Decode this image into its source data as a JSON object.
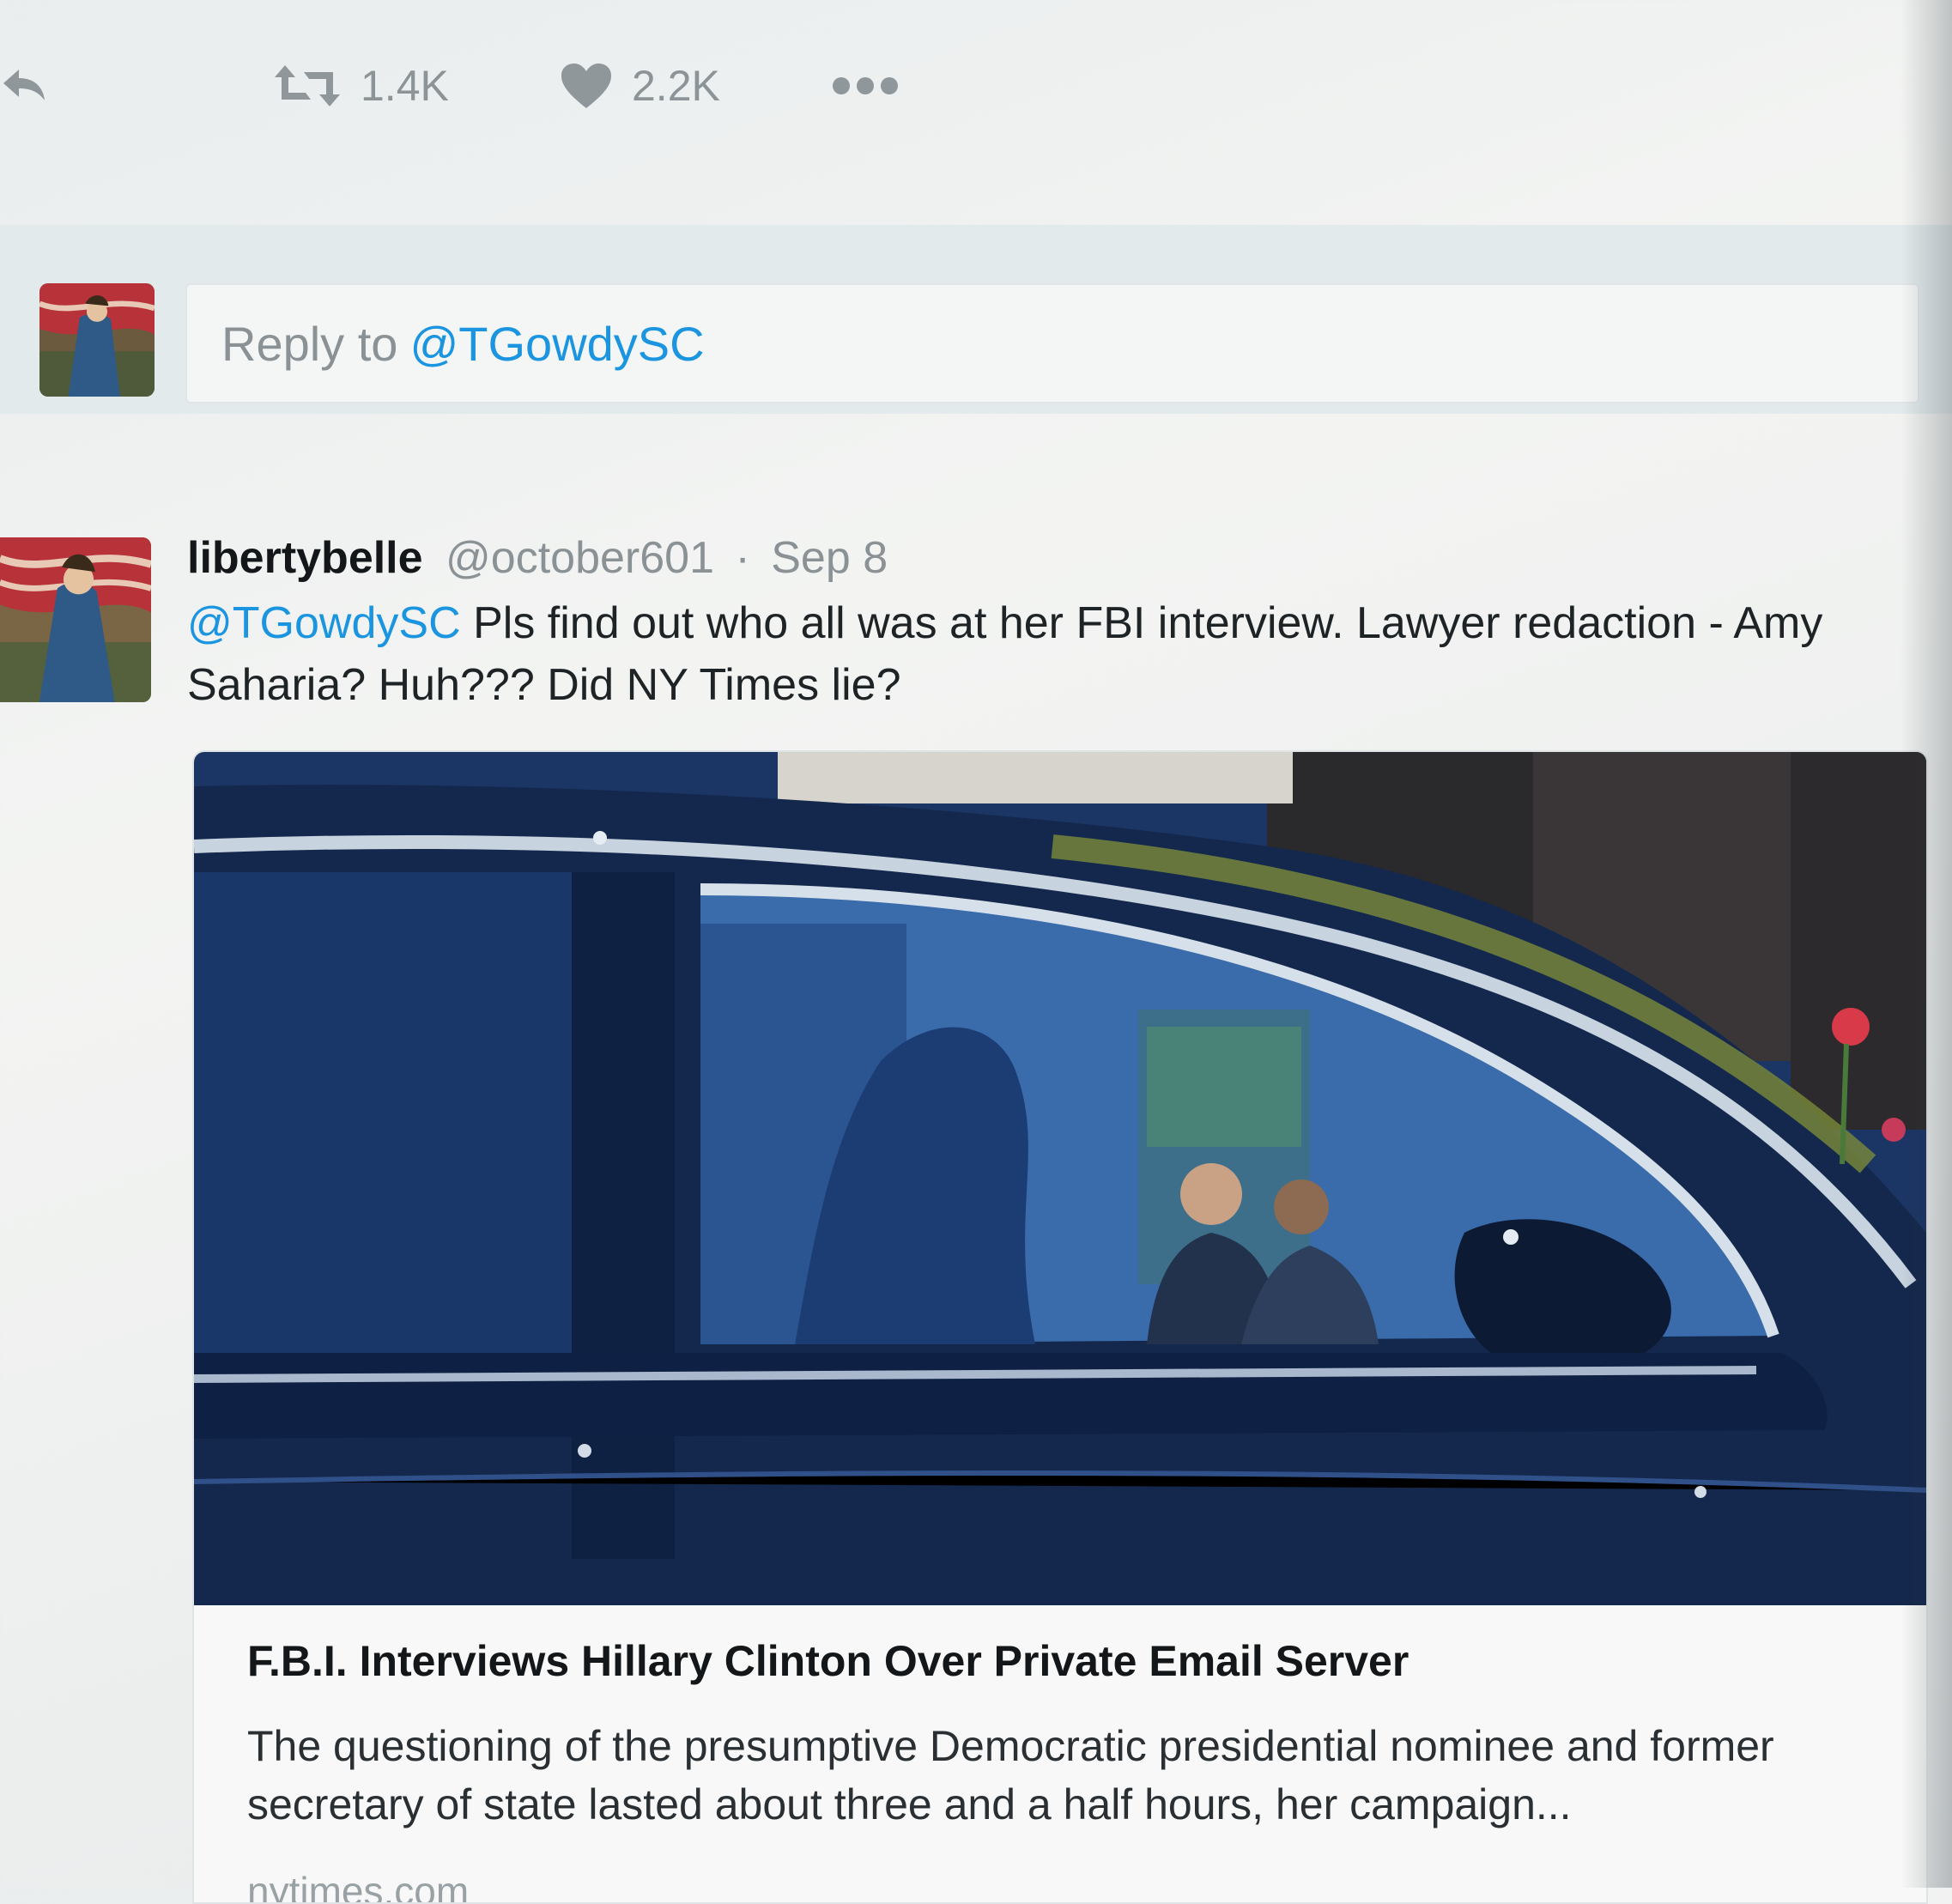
{
  "actions": {
    "reply_icon": "reply-icon",
    "retweet_icon": "retweet-icon",
    "retweet_count": "1.4K",
    "like_icon": "heart-icon",
    "like_count": "2.2K",
    "more_icon": "more-dots-icon",
    "icon_color": "#8f979b"
  },
  "reply_box": {
    "prefix": "Reply to",
    "handle": "@TGowdySC"
  },
  "tweet": {
    "display_name": "libertybelle",
    "screen_name": "@october601",
    "separator": "·",
    "date": "Sep 8",
    "mention": "@TGowdySC",
    "text": "Pls find out who all was at her FBI interview.  Lawyer redaction - Amy Saharia?  Huh???  Did NY Times lie?"
  },
  "card": {
    "title": "F.B.I. Interviews Hillary Clinton Over Private Email Server",
    "description": "The questioning of the presumptive Democratic presidential nominee and former secretary of state lasted about three and a half hours, her campaign...",
    "domain": "nytimes.com"
  },
  "colors": {
    "link": "#1b95e0",
    "muted": "#8a9296"
  }
}
